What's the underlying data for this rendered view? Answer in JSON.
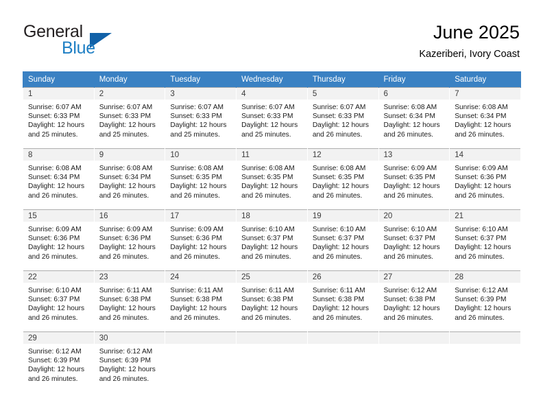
{
  "brand": {
    "name_part1": "General",
    "name_part2": "Blue",
    "logo_icon": "triangle-logo-icon"
  },
  "header": {
    "title": "June 2025",
    "location": "Kazeriberi, Ivory Coast"
  },
  "colors": {
    "header_blue": "#3a81c3",
    "brand_blue": "#1f7fc4",
    "logo_blue": "#1161a8",
    "daynum_band": "#f2f2f2",
    "grid_line": "#aeaeae"
  },
  "calendar": {
    "weekday_headers": [
      "Sunday",
      "Monday",
      "Tuesday",
      "Wednesday",
      "Thursday",
      "Friday",
      "Saturday"
    ],
    "labels": {
      "sunrise": "Sunrise:",
      "sunset": "Sunset:",
      "daylight": "Daylight:"
    },
    "weeks": [
      [
        {
          "day": "1",
          "sunrise": "Sunrise: 6:07 AM",
          "sunset": "Sunset: 6:33 PM",
          "daylight_line1": "Daylight: 12 hours",
          "daylight_line2": "and 25 minutes."
        },
        {
          "day": "2",
          "sunrise": "Sunrise: 6:07 AM",
          "sunset": "Sunset: 6:33 PM",
          "daylight_line1": "Daylight: 12 hours",
          "daylight_line2": "and 25 minutes."
        },
        {
          "day": "3",
          "sunrise": "Sunrise: 6:07 AM",
          "sunset": "Sunset: 6:33 PM",
          "daylight_line1": "Daylight: 12 hours",
          "daylight_line2": "and 25 minutes."
        },
        {
          "day": "4",
          "sunrise": "Sunrise: 6:07 AM",
          "sunset": "Sunset: 6:33 PM",
          "daylight_line1": "Daylight: 12 hours",
          "daylight_line2": "and 25 minutes."
        },
        {
          "day": "5",
          "sunrise": "Sunrise: 6:07 AM",
          "sunset": "Sunset: 6:33 PM",
          "daylight_line1": "Daylight: 12 hours",
          "daylight_line2": "and 26 minutes."
        },
        {
          "day": "6",
          "sunrise": "Sunrise: 6:08 AM",
          "sunset": "Sunset: 6:34 PM",
          "daylight_line1": "Daylight: 12 hours",
          "daylight_line2": "and 26 minutes."
        },
        {
          "day": "7",
          "sunrise": "Sunrise: 6:08 AM",
          "sunset": "Sunset: 6:34 PM",
          "daylight_line1": "Daylight: 12 hours",
          "daylight_line2": "and 26 minutes."
        }
      ],
      [
        {
          "day": "8",
          "sunrise": "Sunrise: 6:08 AM",
          "sunset": "Sunset: 6:34 PM",
          "daylight_line1": "Daylight: 12 hours",
          "daylight_line2": "and 26 minutes."
        },
        {
          "day": "9",
          "sunrise": "Sunrise: 6:08 AM",
          "sunset": "Sunset: 6:34 PM",
          "daylight_line1": "Daylight: 12 hours",
          "daylight_line2": "and 26 minutes."
        },
        {
          "day": "10",
          "sunrise": "Sunrise: 6:08 AM",
          "sunset": "Sunset: 6:35 PM",
          "daylight_line1": "Daylight: 12 hours",
          "daylight_line2": "and 26 minutes."
        },
        {
          "day": "11",
          "sunrise": "Sunrise: 6:08 AM",
          "sunset": "Sunset: 6:35 PM",
          "daylight_line1": "Daylight: 12 hours",
          "daylight_line2": "and 26 minutes."
        },
        {
          "day": "12",
          "sunrise": "Sunrise: 6:08 AM",
          "sunset": "Sunset: 6:35 PM",
          "daylight_line1": "Daylight: 12 hours",
          "daylight_line2": "and 26 minutes."
        },
        {
          "day": "13",
          "sunrise": "Sunrise: 6:09 AM",
          "sunset": "Sunset: 6:35 PM",
          "daylight_line1": "Daylight: 12 hours",
          "daylight_line2": "and 26 minutes."
        },
        {
          "day": "14",
          "sunrise": "Sunrise: 6:09 AM",
          "sunset": "Sunset: 6:36 PM",
          "daylight_line1": "Daylight: 12 hours",
          "daylight_line2": "and 26 minutes."
        }
      ],
      [
        {
          "day": "15",
          "sunrise": "Sunrise: 6:09 AM",
          "sunset": "Sunset: 6:36 PM",
          "daylight_line1": "Daylight: 12 hours",
          "daylight_line2": "and 26 minutes."
        },
        {
          "day": "16",
          "sunrise": "Sunrise: 6:09 AM",
          "sunset": "Sunset: 6:36 PM",
          "daylight_line1": "Daylight: 12 hours",
          "daylight_line2": "and 26 minutes."
        },
        {
          "day": "17",
          "sunrise": "Sunrise: 6:09 AM",
          "sunset": "Sunset: 6:36 PM",
          "daylight_line1": "Daylight: 12 hours",
          "daylight_line2": "and 26 minutes."
        },
        {
          "day": "18",
          "sunrise": "Sunrise: 6:10 AM",
          "sunset": "Sunset: 6:37 PM",
          "daylight_line1": "Daylight: 12 hours",
          "daylight_line2": "and 26 minutes."
        },
        {
          "day": "19",
          "sunrise": "Sunrise: 6:10 AM",
          "sunset": "Sunset: 6:37 PM",
          "daylight_line1": "Daylight: 12 hours",
          "daylight_line2": "and 26 minutes."
        },
        {
          "day": "20",
          "sunrise": "Sunrise: 6:10 AM",
          "sunset": "Sunset: 6:37 PM",
          "daylight_line1": "Daylight: 12 hours",
          "daylight_line2": "and 26 minutes."
        },
        {
          "day": "21",
          "sunrise": "Sunrise: 6:10 AM",
          "sunset": "Sunset: 6:37 PM",
          "daylight_line1": "Daylight: 12 hours",
          "daylight_line2": "and 26 minutes."
        }
      ],
      [
        {
          "day": "22",
          "sunrise": "Sunrise: 6:10 AM",
          "sunset": "Sunset: 6:37 PM",
          "daylight_line1": "Daylight: 12 hours",
          "daylight_line2": "and 26 minutes."
        },
        {
          "day": "23",
          "sunrise": "Sunrise: 6:11 AM",
          "sunset": "Sunset: 6:38 PM",
          "daylight_line1": "Daylight: 12 hours",
          "daylight_line2": "and 26 minutes."
        },
        {
          "day": "24",
          "sunrise": "Sunrise: 6:11 AM",
          "sunset": "Sunset: 6:38 PM",
          "daylight_line1": "Daylight: 12 hours",
          "daylight_line2": "and 26 minutes."
        },
        {
          "day": "25",
          "sunrise": "Sunrise: 6:11 AM",
          "sunset": "Sunset: 6:38 PM",
          "daylight_line1": "Daylight: 12 hours",
          "daylight_line2": "and 26 minutes."
        },
        {
          "day": "26",
          "sunrise": "Sunrise: 6:11 AM",
          "sunset": "Sunset: 6:38 PM",
          "daylight_line1": "Daylight: 12 hours",
          "daylight_line2": "and 26 minutes."
        },
        {
          "day": "27",
          "sunrise": "Sunrise: 6:12 AM",
          "sunset": "Sunset: 6:38 PM",
          "daylight_line1": "Daylight: 12 hours",
          "daylight_line2": "and 26 minutes."
        },
        {
          "day": "28",
          "sunrise": "Sunrise: 6:12 AM",
          "sunset": "Sunset: 6:39 PM",
          "daylight_line1": "Daylight: 12 hours",
          "daylight_line2": "and 26 minutes."
        }
      ],
      [
        {
          "day": "29",
          "sunrise": "Sunrise: 6:12 AM",
          "sunset": "Sunset: 6:39 PM",
          "daylight_line1": "Daylight: 12 hours",
          "daylight_line2": "and 26 minutes."
        },
        {
          "day": "30",
          "sunrise": "Sunrise: 6:12 AM",
          "sunset": "Sunset: 6:39 PM",
          "daylight_line1": "Daylight: 12 hours",
          "daylight_line2": "and 26 minutes."
        },
        {
          "day": "",
          "sunrise": "",
          "sunset": "",
          "daylight_line1": "",
          "daylight_line2": ""
        },
        {
          "day": "",
          "sunrise": "",
          "sunset": "",
          "daylight_line1": "",
          "daylight_line2": ""
        },
        {
          "day": "",
          "sunrise": "",
          "sunset": "",
          "daylight_line1": "",
          "daylight_line2": ""
        },
        {
          "day": "",
          "sunrise": "",
          "sunset": "",
          "daylight_line1": "",
          "daylight_line2": ""
        },
        {
          "day": "",
          "sunrise": "",
          "sunset": "",
          "daylight_line1": "",
          "daylight_line2": ""
        }
      ]
    ]
  }
}
